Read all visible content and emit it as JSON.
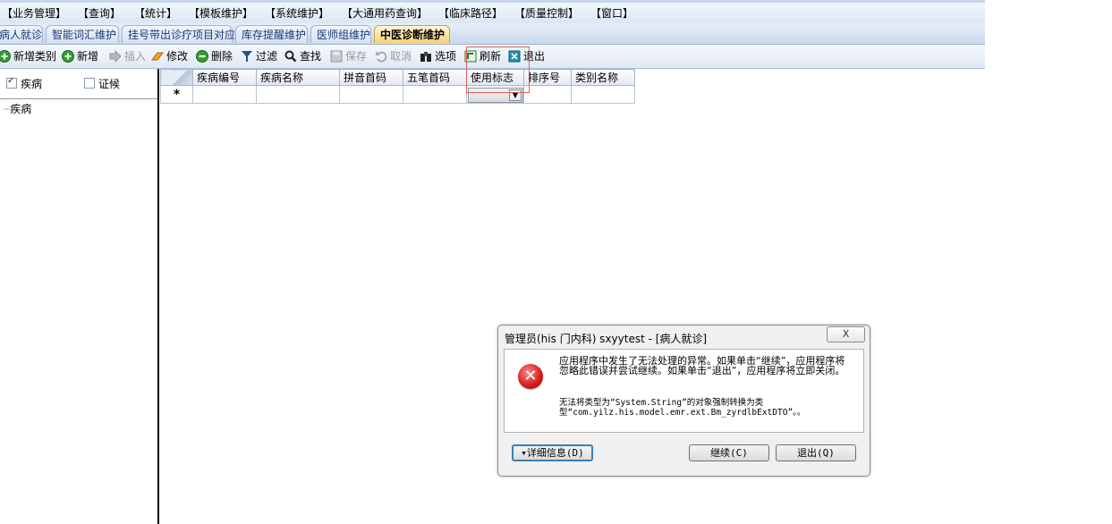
{
  "menu": [
    "【业务管理】",
    "【查询】",
    "【统计】",
    "【模板维护】",
    "【系统维护】",
    "【大通用药查询】",
    "【临床路径】",
    "【质量控制】",
    "【窗口】"
  ],
  "tabs": [
    "病人就诊",
    "智能词汇维护",
    "挂号带出诊疗项目对应",
    "库存提醒维护",
    "医师组维护",
    "中医诊断维护"
  ],
  "toolbar": {
    "new_category": "新增类别",
    "new": "新增",
    "insert": "插入",
    "edit": "修改",
    "delete": "删除",
    "filter": "过滤",
    "find": "查找",
    "save": "保存",
    "cancel": "取消",
    "options": "选项",
    "refresh": "刷新",
    "exit": "退出"
  },
  "left_panel": {
    "checkbox_disease": "疾病",
    "checkbox_disease_checked": true,
    "checkbox_syndrome": "证候",
    "checkbox_syndrome_checked": false,
    "tree_root": "疾病"
  },
  "grid": {
    "columns": [
      "疾病编号",
      "疾病名称",
      "拼音首码",
      "五笔首码",
      "使用标志",
      "排序号",
      "类别名称"
    ],
    "new_row_marker": "*"
  },
  "dialog": {
    "title": "管理员(his 门内科) sxyytest - [病人就诊]",
    "close_label": "X",
    "message": "应用程序中发生了无法处理的异常。如果单击“继续”，应用程序将忽略此错误并尝试继续。如果单击“退出”，应用程序将立即关闭。",
    "detail": "无法将类型为“System.String”的对象强制转换为类型“com.yilz.his.model.emr.ext.Bm_zyrdlbExtDTO”。。",
    "details_button": "▾详细信息(D)",
    "continue_button": "继续(C)",
    "quit_button": "退出(Q)"
  },
  "colors": {
    "error_red": "#d11a1a",
    "active_tab": "#f7d27a",
    "highlight_box": "#e06060"
  }
}
